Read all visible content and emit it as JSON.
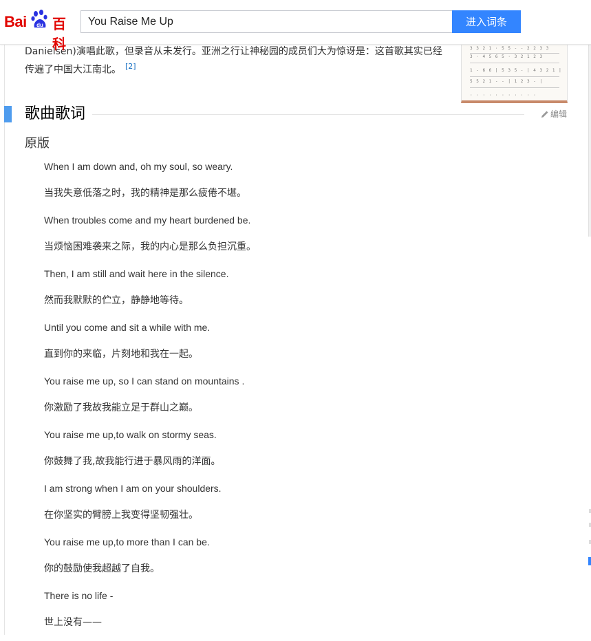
{
  "header": {
    "logo_text_left": "Bai",
    "logo_text_paw": "du",
    "logo_text_right": "百科",
    "search_value": "You Raise Me Up",
    "search_button": "进入词条"
  },
  "intro": {
    "text": "Danielsen)演唱此歌，但录音从未发行。亚洲之行让神秘园的成员们大为惊讶是：这首歌其实已经传遍了中国大江南北。",
    "ref": "[2]"
  },
  "section": {
    "title": "歌曲歌词",
    "edit_label": "编辑",
    "subtitle": "原版"
  },
  "lyrics": [
    {
      "text": "When I am down and, oh my soul, so weary.",
      "lang": "en"
    },
    {
      "text": "当我失意低落之时，我的精神是那么疲倦不堪。",
      "lang": "cn"
    },
    {
      "text": "When troubles come and my heart burdened be.",
      "lang": "en"
    },
    {
      "text": "当烦恼困难袭来之际，我的内心是那么负担沉重。",
      "lang": "cn"
    },
    {
      "text": "Then, I am still and wait here in the silence.",
      "lang": "en"
    },
    {
      "text": "然而我默默的伫立，静静地等待。",
      "lang": "cn"
    },
    {
      "text": "Until you come and sit a while with me.",
      "lang": "en"
    },
    {
      "text": "直到你的来临，片刻地和我在一起。",
      "lang": "cn"
    },
    {
      "text": "You raise me up, so I can stand on mountains .",
      "lang": "en"
    },
    {
      "text": "你激励了我故我能立足于群山之巅。",
      "lang": "cn"
    },
    {
      "text": "You raise me up,to walk on stormy seas.",
      "lang": "en"
    },
    {
      "text": "你鼓舞了我,故我能行进于暴风雨的洋面。",
      "lang": "cn"
    },
    {
      "text": "I am strong when I am on your shoulders.",
      "lang": "en"
    },
    {
      "text": "在你坚实的臂膀上我变得坚韧强壮。",
      "lang": "cn"
    },
    {
      "text": "You raise me up,to more than I can be.",
      "lang": "en"
    },
    {
      "text": "你的鼓励使我超越了自我。",
      "lang": "cn"
    },
    {
      "text": "There is no life -",
      "lang": "en"
    },
    {
      "text": "世上没有——",
      "lang": "cn"
    }
  ],
  "colors": {
    "brand_red": "#e10601",
    "search_blue": "#3385ff",
    "section_bar": "#4f9cee",
    "link_blue": "#136ec2"
  }
}
